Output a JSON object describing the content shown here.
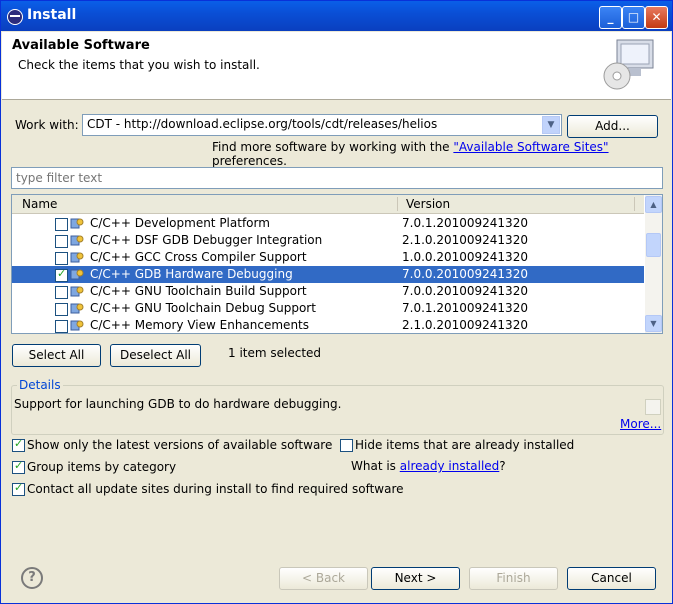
{
  "window": {
    "title": "Install"
  },
  "header": {
    "title": "Available Software",
    "subtitle": "Check the items that you wish to install."
  },
  "work_with": {
    "label": "Work with:",
    "value": "CDT - http://download.eclipse.org/tools/cdt/releases/helios",
    "add_label": "Add...",
    "find_prefix": "Find more software by working with the ",
    "find_link": "\"Available Software Sites\"",
    "find_suffix": " preferences."
  },
  "filter": {
    "placeholder": "type filter text"
  },
  "table": {
    "columns": [
      "Name",
      "Version"
    ],
    "rows": [
      {
        "checked": false,
        "name": "C/C++ Development Platform",
        "version": "7.0.1.201009241320",
        "selected": false
      },
      {
        "checked": false,
        "name": "C/C++ DSF GDB Debugger Integration",
        "version": "2.1.0.201009241320",
        "selected": false
      },
      {
        "checked": false,
        "name": "C/C++ GCC Cross Compiler Support",
        "version": "1.0.0.201009241320",
        "selected": false
      },
      {
        "checked": true,
        "name": "C/C++ GDB Hardware Debugging",
        "version": "7.0.0.201009241320",
        "selected": true
      },
      {
        "checked": false,
        "name": "C/C++ GNU Toolchain Build Support",
        "version": "7.0.0.201009241320",
        "selected": false
      },
      {
        "checked": false,
        "name": "C/C++ GNU Toolchain Debug Support",
        "version": "7.0.1.201009241320",
        "selected": false
      },
      {
        "checked": false,
        "name": "C/C++ Memory View Enhancements",
        "version": "2.1.0.201009241320",
        "selected": false
      }
    ]
  },
  "selection": {
    "select_all": "Select All",
    "deselect_all": "Deselect All",
    "status": "1 item selected"
  },
  "details": {
    "title": "Details",
    "text": "Support for launching GDB to do hardware debugging.",
    "more": "More..."
  },
  "options": {
    "latest": {
      "label": "Show only the latest versions of available software",
      "checked": true
    },
    "hide_installed": {
      "label": "Hide items that are already installed",
      "checked": false
    },
    "group": {
      "label": "Group items by category",
      "checked": true
    },
    "what_is_prefix": "What is ",
    "already_installed_link": "already installed",
    "what_is_suffix": "?",
    "contact": {
      "label": "Contact all update sites during install to find required software",
      "checked": true
    }
  },
  "footer": {
    "back": "< Back",
    "next": "Next >",
    "finish": "Finish",
    "cancel": "Cancel"
  },
  "colors": {
    "selection": "#316ac5",
    "link": "#0000ee",
    "titlebar": "#0a4fd6"
  }
}
